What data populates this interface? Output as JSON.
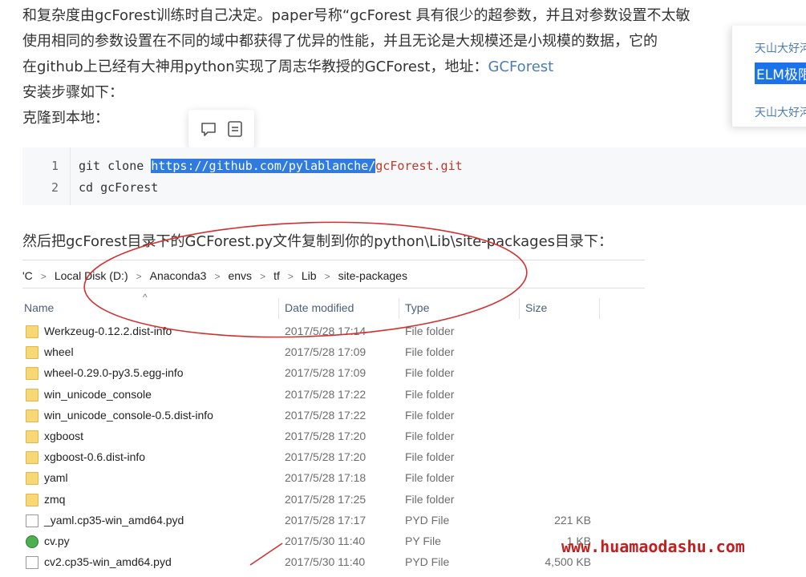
{
  "article": {
    "line1": "和复杂度由gcForest训练时自己决定。paper号称“gcForest 具有很少的超参数，并且对参数设置不太敏",
    "line2": "使用相同的参数设置在不同的域中都获得了优异的性能，并且无论是大规模还是小规模的数据，它的",
    "line3_prefix": "在github上已经有大神用python实现了周志华教授的GCForest，地址：",
    "line3_link": "GCForest",
    "line4": "安装步骤如下：",
    "line5": "克隆到本地：",
    "line6": "然后把gcForest目录下的GCForest.py文件复制到你的python\\Lib\\site-packages目录下："
  },
  "popup": {
    "item1": "天山大好河",
    "item2": "ELM极限",
    "item3": "天山大好河"
  },
  "code": {
    "line1_num": "1",
    "line1_cmd": "git clone ",
    "line1_hl": "https://github.com/pylablanche/",
    "line1_rest": "gcForest.git",
    "line2_num": "2",
    "line2": "cd gcForest"
  },
  "explorer": {
    "breadcrumb": [
      "'C",
      "Local Disk (D:)",
      "Anaconda3",
      "envs",
      "tf",
      "Lib",
      "site-packages"
    ],
    "columns": {
      "name": "Name",
      "date": "Date modified",
      "type": "Type",
      "size": "Size"
    },
    "files": [
      {
        "name": "Werkzeug-0.12.2.dist-info",
        "date": "2017/5/28 17:14",
        "type": "File folder",
        "size": "",
        "kind": "folder"
      },
      {
        "name": "wheel",
        "date": "2017/5/28 17:09",
        "type": "File folder",
        "size": "",
        "kind": "folder"
      },
      {
        "name": "wheel-0.29.0-py3.5.egg-info",
        "date": "2017/5/28 17:09",
        "type": "File folder",
        "size": "",
        "kind": "folder"
      },
      {
        "name": "win_unicode_console",
        "date": "2017/5/28 17:22",
        "type": "File folder",
        "size": "",
        "kind": "folder"
      },
      {
        "name": "win_unicode_console-0.5.dist-info",
        "date": "2017/5/28 17:22",
        "type": "File folder",
        "size": "",
        "kind": "folder"
      },
      {
        "name": "xgboost",
        "date": "2017/5/28 17:20",
        "type": "File folder",
        "size": "",
        "kind": "folder"
      },
      {
        "name": "xgboost-0.6.dist-info",
        "date": "2017/5/28 17:20",
        "type": "File folder",
        "size": "",
        "kind": "folder"
      },
      {
        "name": "yaml",
        "date": "2017/5/28 17:18",
        "type": "File folder",
        "size": "",
        "kind": "folder"
      },
      {
        "name": "zmq",
        "date": "2017/5/28 17:25",
        "type": "File folder",
        "size": "",
        "kind": "folder"
      },
      {
        "name": "_yaml.cp35-win_amd64.pyd",
        "date": "2017/5/28 17:17",
        "type": "PYD File",
        "size": "221 KB",
        "kind": "file"
      },
      {
        "name": "cv.py",
        "date": "2017/5/30 11:40",
        "type": "PY File",
        "size": "1 KB",
        "kind": "py"
      },
      {
        "name": "cv2.cp35-win_amd64.pyd",
        "date": "2017/5/30 11:40",
        "type": "PYD File",
        "size": "4,500 KB",
        "kind": "file"
      }
    ]
  },
  "watermark": "www.huamaodashu.com",
  "colors": {
    "link": "#4a7eb3",
    "highlight": "#2f7be0",
    "annotation": "#d32f2f",
    "watermark": "#c41e1e"
  }
}
